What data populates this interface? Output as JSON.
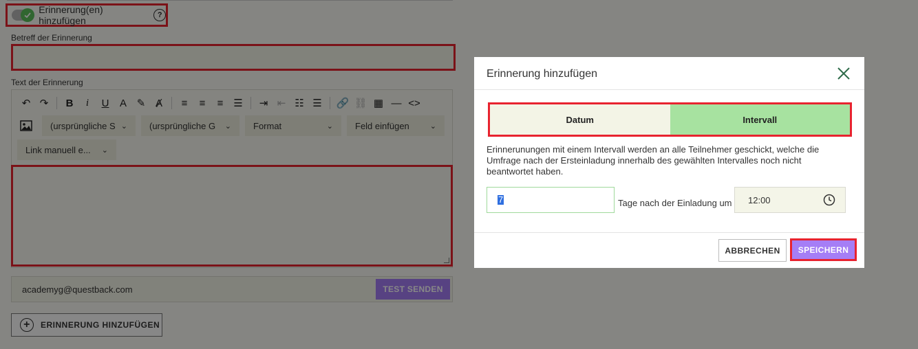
{
  "background": {
    "toggle_label": "Erinnerung(en) hinzufügen",
    "help_symbol": "?",
    "subject_label": "Betreff der Erinnerung",
    "text_label": "Text der Erinnerung",
    "toolbar": {
      "font_select": "(ursprüngliche S",
      "size_select": "(ursprüngliche G",
      "format_select": "Format",
      "field_select": "Feld einfügen",
      "link_select": "Link manuell e..."
    },
    "email_value": "academyg@questback.com",
    "test_button": "TEST SENDEN",
    "add_button": "ERINNERUNG HINZUFÜGEN"
  },
  "modal": {
    "title": "Erinnerung hinzufügen",
    "tabs": [
      "Datum",
      "Intervall"
    ],
    "active_tab": "Intervall",
    "description": "Erinnerunungen mit einem Intervall werden an alle Teilnehmer geschickt, welche die Umfrage nach der Ersteinladung innerhalb des gewählten Intervalles noch nicht beantwortet haben.",
    "days_value": "7",
    "days_label": "Tage nach der Einladung um",
    "time_value": "12:00",
    "cancel_button": "ABBRECHEN",
    "save_button": "SPEICHERN"
  },
  "colors": {
    "highlight_red": "#e8232f",
    "primary_purple": "#a57ef6",
    "active_tab_green": "#a7e2a0",
    "toggle_green": "#5cc05c"
  }
}
